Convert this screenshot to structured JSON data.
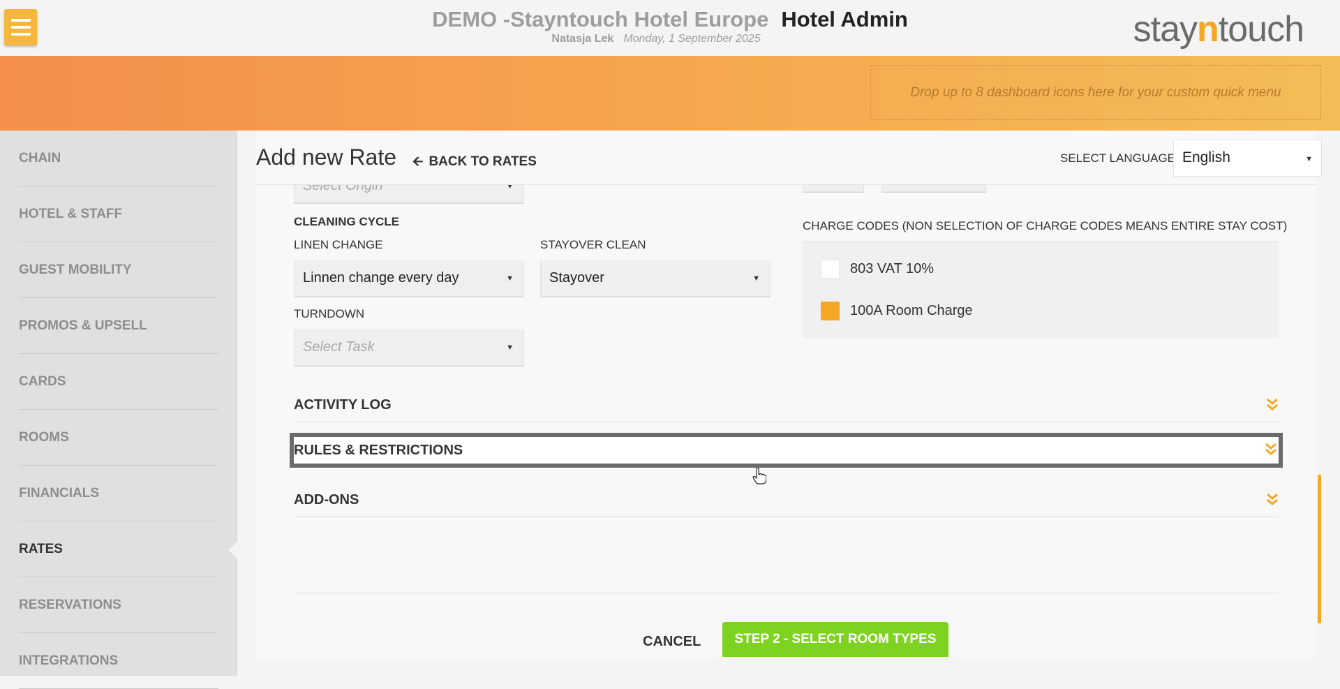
{
  "header": {
    "hotel_name": "DEMO -Stayntouch Hotel Europe",
    "app_name": "Hotel Admin",
    "user_name": "Natasja Lek",
    "date": "Monday, 1 September 2025",
    "brand_prefix": "stay",
    "brand_highlight": "n",
    "brand_suffix": "touch"
  },
  "quick_menu": {
    "drop_text": "Drop up to 8 dashboard icons here for your custom quick menu"
  },
  "sidebar": {
    "items": [
      {
        "label": "CHAIN"
      },
      {
        "label": "HOTEL & STAFF"
      },
      {
        "label": "GUEST MOBILITY"
      },
      {
        "label": "PROMOS & UPSELL"
      },
      {
        "label": "CARDS"
      },
      {
        "label": "ROOMS"
      },
      {
        "label": "FINANCIALS"
      },
      {
        "label": "RATES"
      },
      {
        "label": "RESERVATIONS"
      },
      {
        "label": "INTEGRATIONS"
      }
    ],
    "active": "RATES"
  },
  "page": {
    "title": "Add new Rate",
    "back_label": "BACK TO RATES",
    "language_label": "SELECT LANGUAGE",
    "language_value": "English"
  },
  "form": {
    "origin_placeholder": "Select Origin",
    "cleaning_cycle_label": "CLEANING CYCLE",
    "linen_change_label": "LINEN CHANGE",
    "linen_change_value": "Linnen change every day",
    "stayover_clean_label": "STAYOVER CLEAN",
    "stayover_clean_value": "Stayover",
    "turndown_label": "TURNDOWN",
    "turndown_placeholder": "Select Task",
    "charge_codes_label": "CHARGE CODES (NON SELECTION OF CHARGE CODES MEANS ENTIRE STAY COST)",
    "charge_codes": [
      {
        "label": "803 VAT 10%",
        "checked": false
      },
      {
        "label": "100A Room Charge",
        "checked": true
      }
    ]
  },
  "sections": {
    "activity_log": "ACTIVITY LOG",
    "rules_restrictions": "RULES & RESTRICTIONS",
    "add_ons": "ADD-ONS"
  },
  "actions": {
    "cancel": "CANCEL",
    "next_step": "STEP 2 - SELECT ROOM TYPES"
  },
  "colors": {
    "accent": "#f5a623",
    "primary_button": "#7ed321",
    "highlight_border": "#6b6b6b"
  }
}
